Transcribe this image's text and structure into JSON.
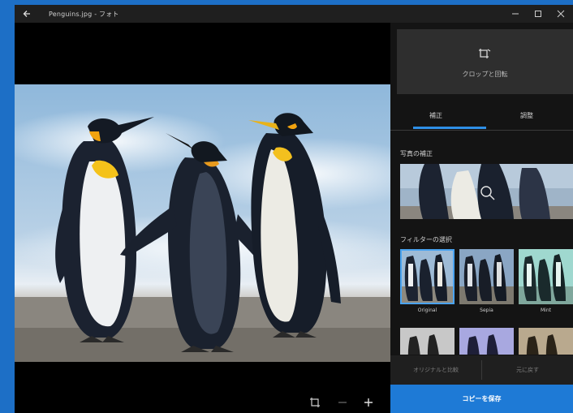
{
  "window": {
    "title": "Penguins.jpg - フォト",
    "min_icon": "minimize-icon",
    "max_icon": "maximize-icon",
    "close_icon": "close-icon",
    "back_icon": "back-arrow-icon"
  },
  "panel": {
    "rotate_label": "クロップと回転",
    "tabs": [
      {
        "label": "補正"
      },
      {
        "label": "調整"
      }
    ],
    "enhance_label": "写真の補正",
    "filter_label": "フィルターの選択",
    "filters": [
      {
        "name": "Original"
      },
      {
        "name": "Sepia"
      },
      {
        "name": "Mint"
      }
    ],
    "compare_label": "オリジナルと比較",
    "reset_label": "元に戻す",
    "save_label": "コピーを保存"
  },
  "colors": {
    "accent": "#1e7ad6",
    "tab_underline": "#2e8fe6",
    "desktop": "#1d6fc6"
  }
}
